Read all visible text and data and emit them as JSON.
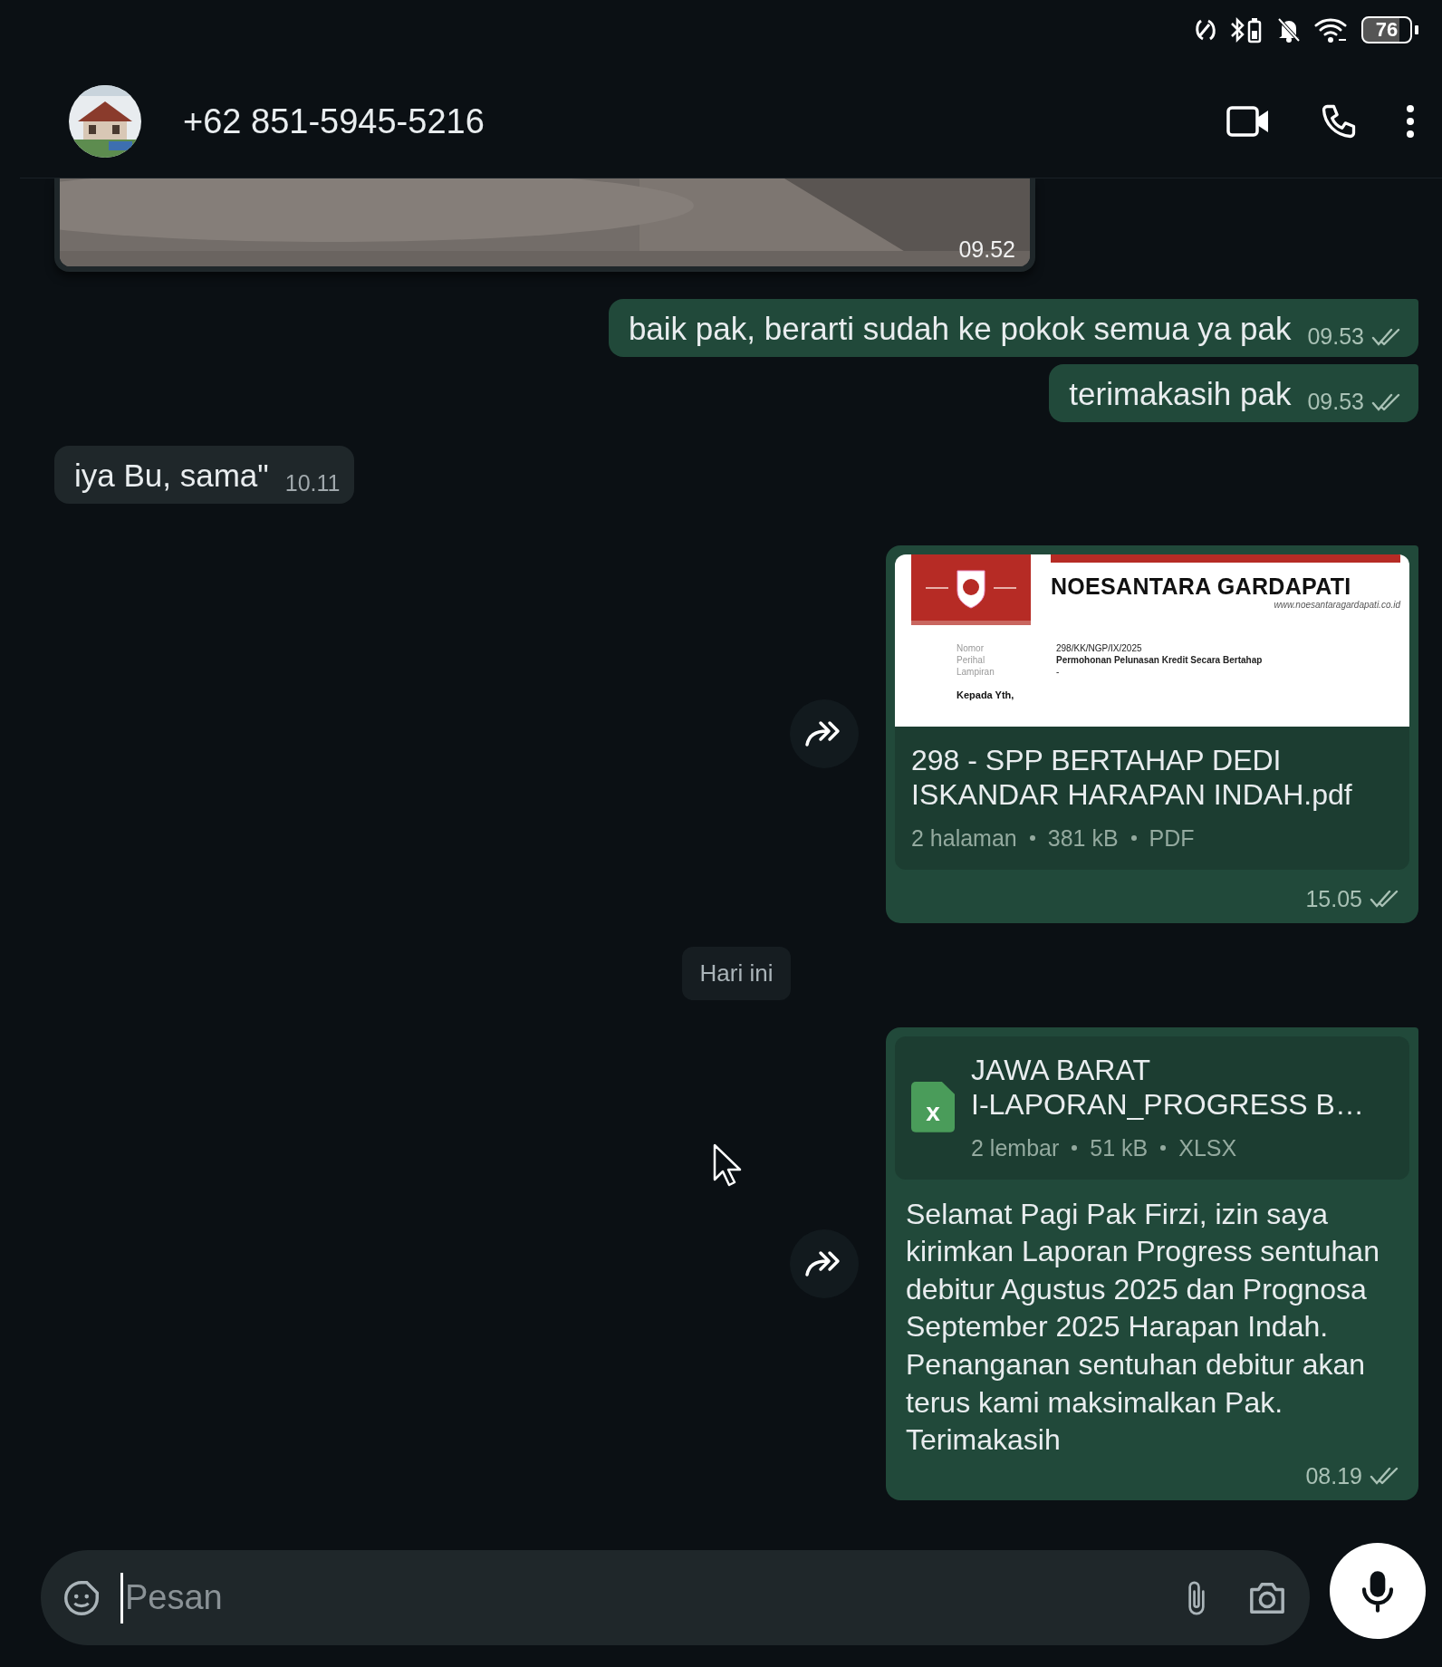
{
  "status_bar": {
    "battery": "76"
  },
  "header": {
    "contact": "+62 851-5945-5216"
  },
  "messages": [
    {
      "outgoing": false,
      "time": "09.52"
    },
    {
      "kind": "text",
      "outgoing": true,
      "text": "baik pak, berarti sudah ke pokok semua ya pak",
      "time": "09.53",
      "read": true
    },
    {
      "kind": "text",
      "outgoing": true,
      "text": "terimakasih pak",
      "time": "09.53",
      "read": true
    },
    {
      "kind": "text",
      "outgoing": false,
      "text": "iya Bu, sama\"",
      "time": "10.11"
    },
    {
      "kind": "document",
      "outgoing": true,
      "forward": true,
      "preview": {
        "company": "NOESANTARA GARDAPATI",
        "website": "www.noesantaragardapati.co.id",
        "fields": [
          {
            "label": "Nomor",
            "value": "298/KK/NGP/IX/2025"
          },
          {
            "label": "Perihal",
            "value": "Permohonan Pelunasan Kredit Secara Bertahap"
          },
          {
            "label": "Lampiran",
            "value": "-"
          }
        ],
        "greeting": "Kepada Yth,"
      },
      "file_name": "298 - SPP BERTAHAP DEDI ISKANDAR HARAPAN INDAH.pdf",
      "meta": [
        "2 halaman",
        "381 kB",
        "PDF"
      ],
      "time": "15.05",
      "read": true
    },
    {
      "kind": "date",
      "text": "Hari ini"
    },
    {
      "kind": "spreadsheet",
      "outgoing": true,
      "forward": true,
      "icon_label": "x",
      "file_name": "JAWA BARAT\nI-LAPORAN_PROGRESS B…",
      "meta": [
        "2 lembar",
        "51 kB",
        "XLSX"
      ],
      "caption": "Selamat Pagi Pak Firzi, izin saya kirimkan Laporan Progress sentuhan debitur Agustus 2025 dan Prognosa September 2025 Harapan Indah. Penanganan sentuhan debitur akan terus kami maksimalkan Pak. Terimakasih",
      "time": "08.19",
      "read": true
    }
  ],
  "composer": {
    "placeholder": "Pesan"
  }
}
